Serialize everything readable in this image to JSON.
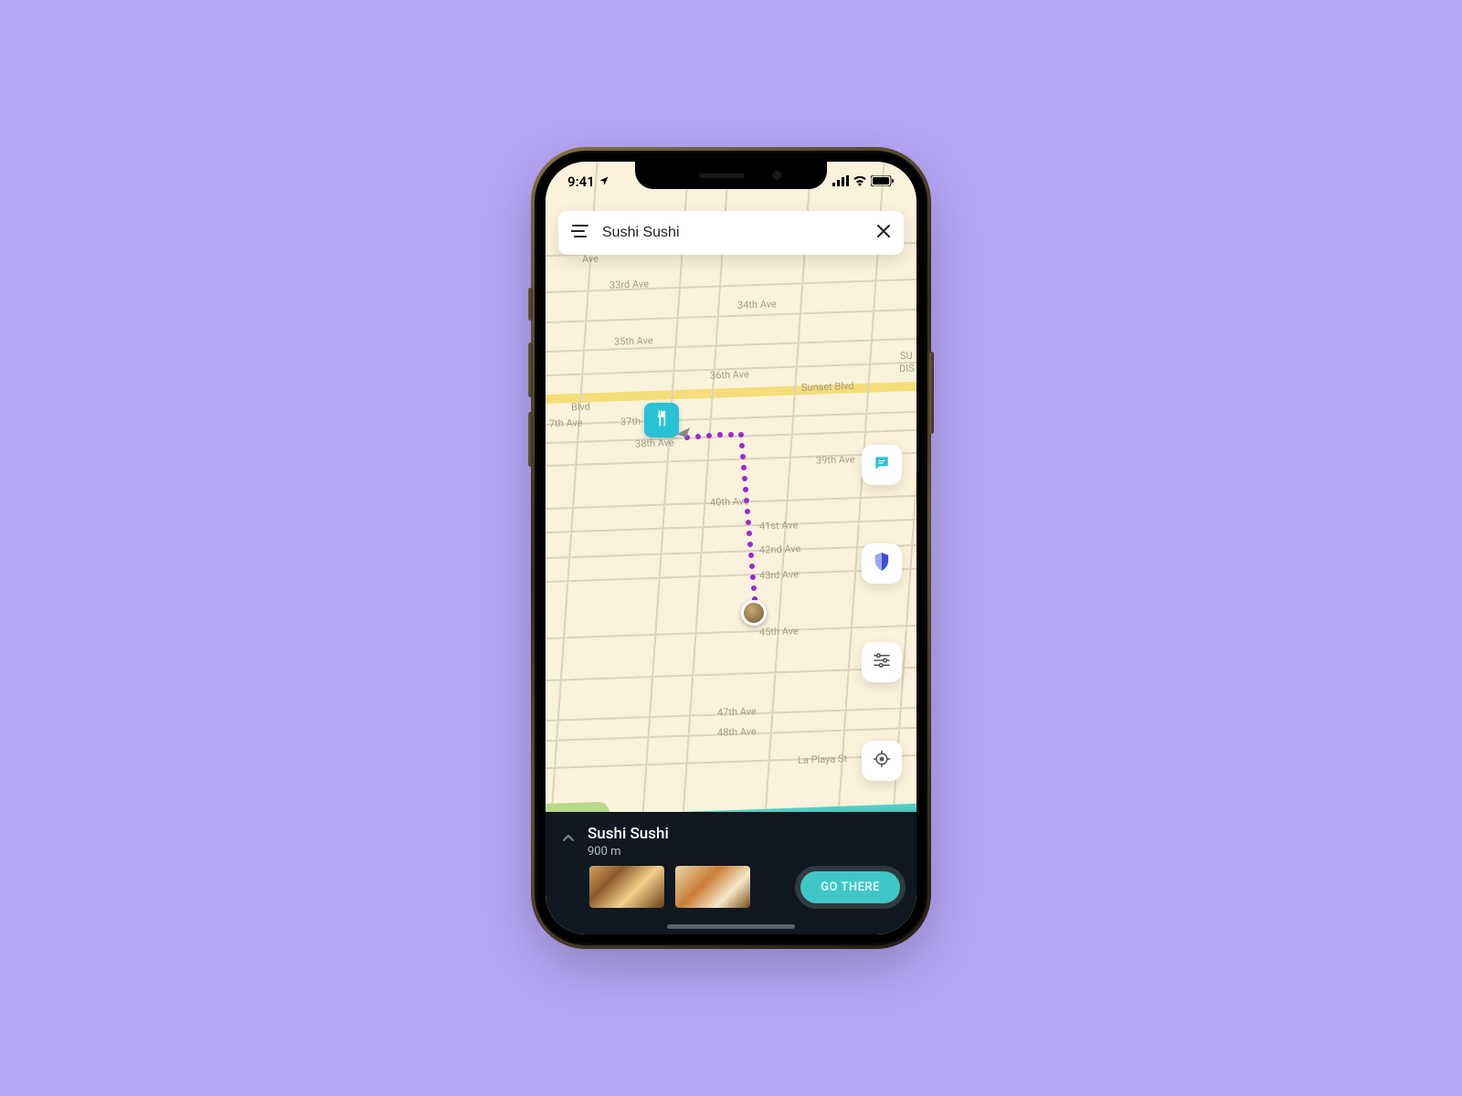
{
  "statusbar": {
    "time": "9:41"
  },
  "search": {
    "value": "Sushi Sushi"
  },
  "streets": {
    "h": [
      "Ave",
      "33rd Ave",
      "34th Ave",
      "35th Ave",
      "36th Ave",
      "Sunset Blvd",
      "Blvd",
      "7th Ave",
      "37th",
      "38th Ave",
      "39th Ave",
      "40th Ave",
      "41st Ave",
      "42nd Ave",
      "43rd Ave",
      "45th Ave",
      "47th Ave",
      "48th Ave",
      "La Playa St"
    ],
    "partial": [
      "SU",
      "DIS"
    ]
  },
  "destination": {
    "name": "Sushi Sushi",
    "distance": "900 m"
  },
  "cta": {
    "label": "GO THERE"
  },
  "icons": {
    "menu": "menu-icon",
    "close": "close-icon",
    "chat": "chat-icon",
    "shield": "shield-icon",
    "sliders": "sliders-icon",
    "locate": "locate-icon",
    "fork": "restaurant-icon",
    "chevron": "chevron-up-icon",
    "location_arrow": "location-arrow-icon"
  },
  "colors": {
    "accent": "#27c3d4",
    "route": "#9c27d4",
    "cta": "#3fc7c7",
    "panel": "#0f1820"
  }
}
